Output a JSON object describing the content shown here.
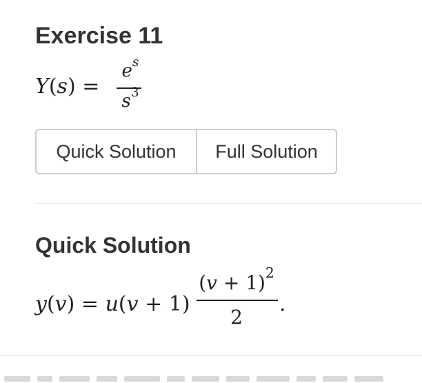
{
  "exercise": {
    "title": "Exercise 11",
    "equation": {
      "lhs_fn": "Y",
      "lhs_open": "(",
      "lhs_var": "s",
      "lhs_close": ")",
      "equals": "=",
      "num_base": "e",
      "num_exp": "s",
      "den_base": "s",
      "den_exp": "3"
    }
  },
  "buttons": {
    "quick_label": "Quick Solution",
    "full_label": "Full Solution"
  },
  "quick_solution": {
    "heading": "Quick Solution",
    "equation": {
      "lhs_fn": "y",
      "lhs_open": "(",
      "lhs_var": "v",
      "lhs_close": ")",
      "equals": "=",
      "step_fn": "u",
      "step_arg_open": "(",
      "step_arg_var": "v",
      "step_arg_rest": " + 1)",
      "num_open": "(",
      "num_var": "v",
      "num_rest": " + 1)",
      "num_exp": "2",
      "den": "2",
      "period": "."
    }
  }
}
